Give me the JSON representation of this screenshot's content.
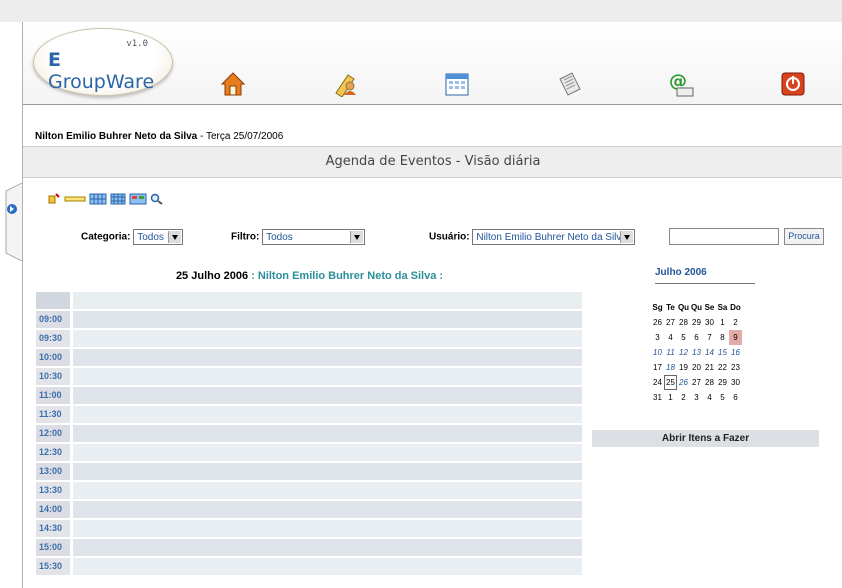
{
  "app": {
    "logo_text": "GroupWare",
    "logo_glyph": "E",
    "version": "v1.0"
  },
  "nav_icons": [
    "home-icon",
    "contacts-icon",
    "calendar-icon",
    "notes-icon",
    "email-icon",
    "logout-icon"
  ],
  "user_line": {
    "name": "Nilton Emilio Buhrer Neto da Silva",
    "date": "Terça 25/07/2006",
    "separator": " - "
  },
  "page_title": "Agenda de Eventos - Visão diária",
  "toolbar_icons": [
    "new-event-icon",
    "day-view-icon",
    "week-view-icon",
    "month-view-icon",
    "year-view-icon",
    "search-icon"
  ],
  "filters": {
    "categoria_label": "Categoria:",
    "categoria_value": "Todos",
    "filtro_label": "Filtro:",
    "filtro_value": "Todos",
    "usuario_label": "Usuário:",
    "usuario_value": "Nilton Emilio Buhrer Neto da Silva",
    "search_button": "Procura"
  },
  "day": {
    "date_label": "25 Julho 2006",
    "who": " : Nilton Emilio Buhrer Neto da Silva :",
    "times": [
      "09:00",
      "09:30",
      "10:00",
      "10:30",
      "11:00",
      "11:30",
      "12:00",
      "12:30",
      "13:00",
      "13:30",
      "14:00",
      "14:30",
      "15:00",
      "15:30"
    ]
  },
  "mini_calendar": {
    "title": "Julho 2006",
    "weekdays": [
      "Sg",
      "Te",
      "Qu",
      "Qu",
      "Se",
      "Sa",
      "Do"
    ],
    "weeks": [
      [
        "26",
        "27",
        "28",
        "29",
        "30",
        "1",
        "2"
      ],
      [
        "3",
        "4",
        "5",
        "6",
        "7",
        "8",
        "9"
      ],
      [
        "10",
        "11",
        "12",
        "13",
        "14",
        "15",
        "16"
      ],
      [
        "17",
        "18",
        "19",
        "20",
        "21",
        "22",
        "23"
      ],
      [
        "24",
        "25",
        "26",
        "27",
        "28",
        "29",
        "30"
      ],
      [
        "31",
        "1",
        "2",
        "3",
        "4",
        "5",
        "6"
      ]
    ]
  },
  "todo_label": "Abrir Itens a Fazer"
}
